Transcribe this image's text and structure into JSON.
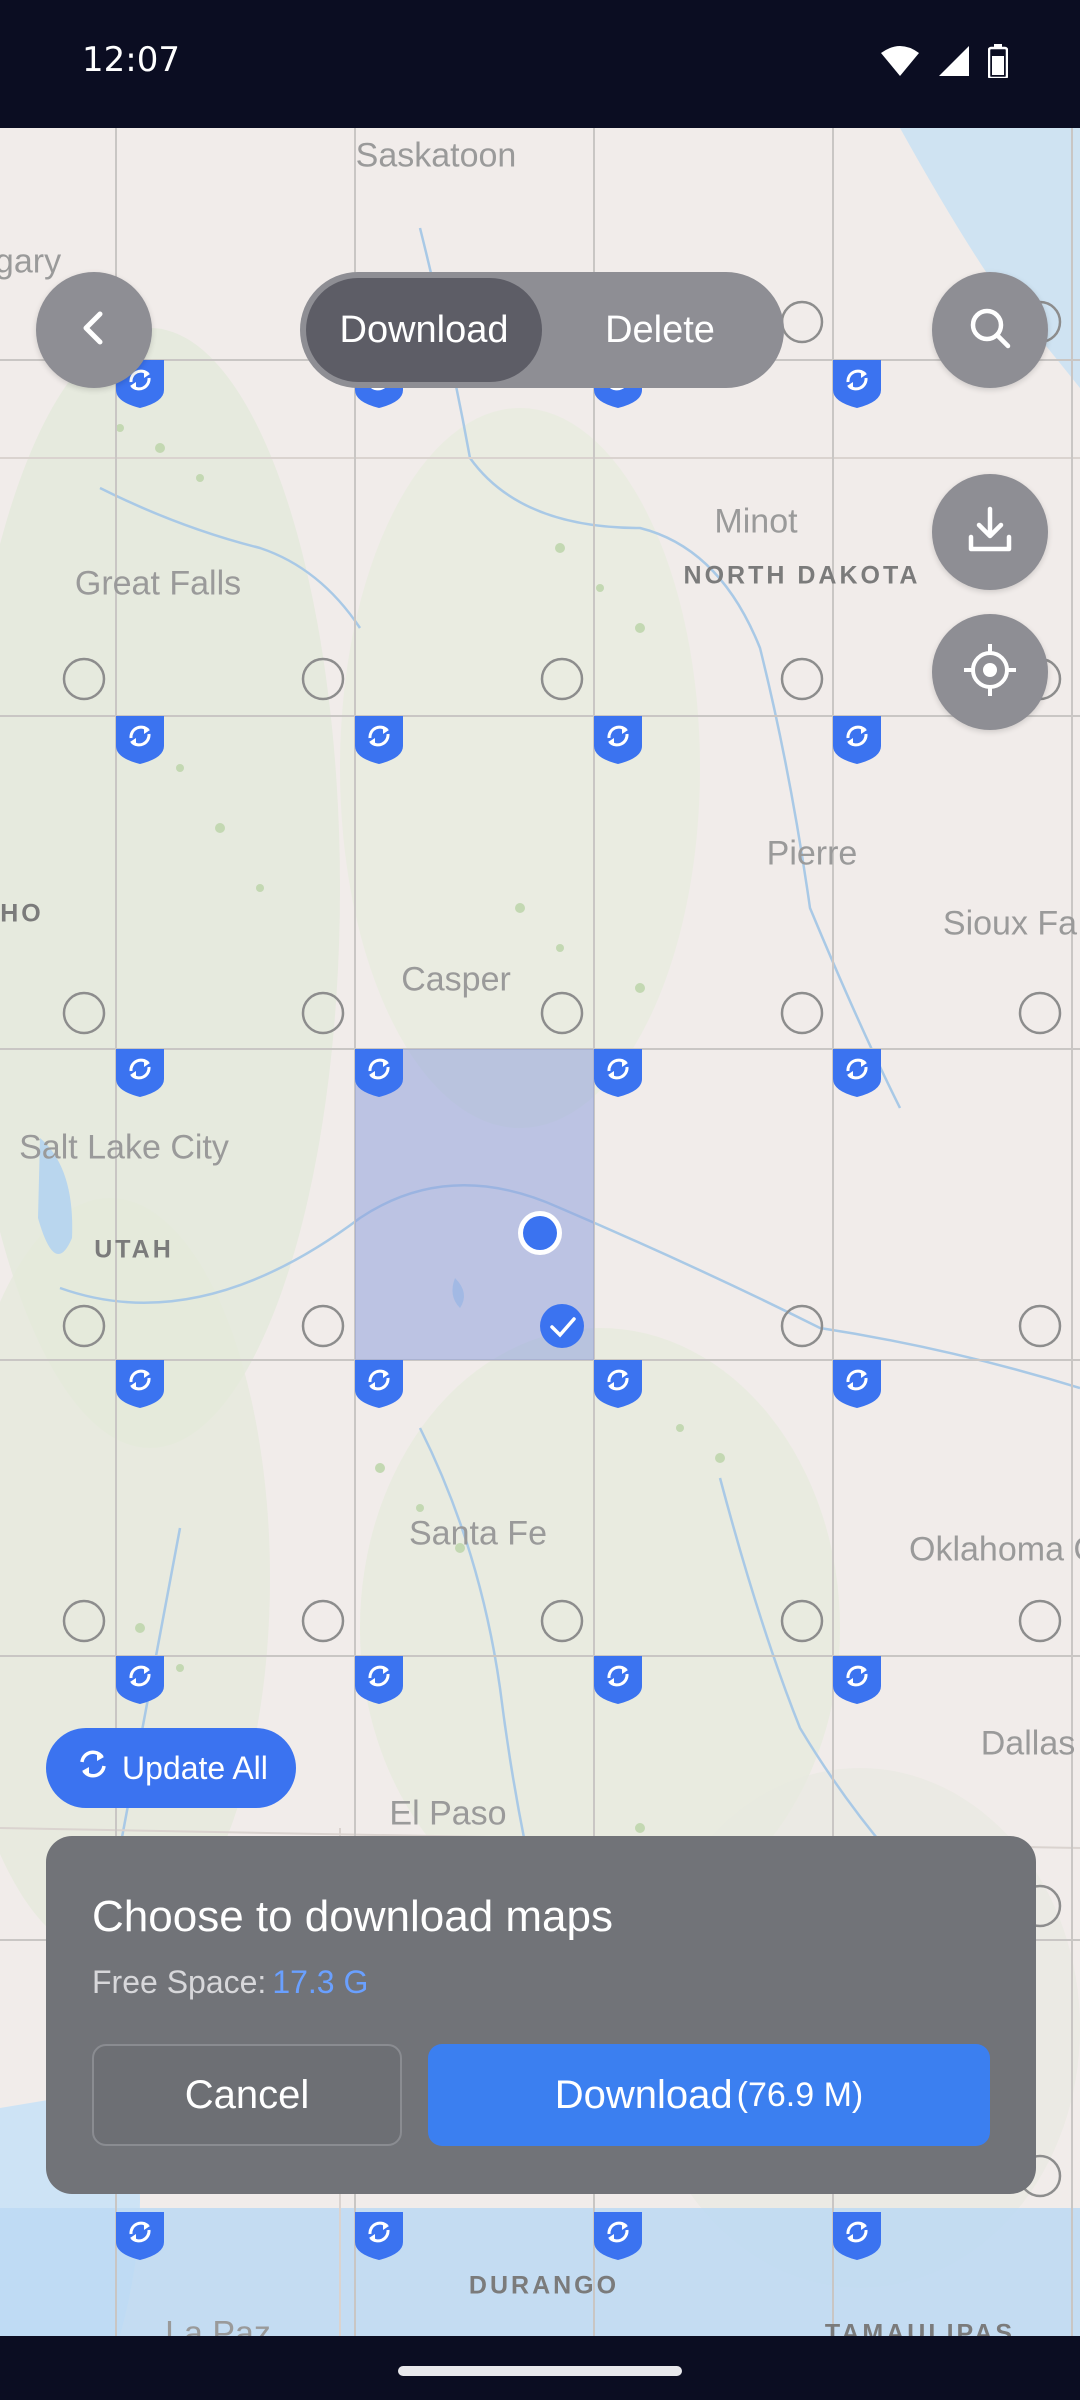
{
  "status_bar": {
    "time": "12:07"
  },
  "toolbar": {
    "back_icon": "chevron-left-icon",
    "segmented": [
      {
        "label": "Download",
        "selected": true
      },
      {
        "label": "Delete",
        "selected": false
      }
    ],
    "search_icon": "search-icon",
    "download_icon": "download-icon",
    "locate_icon": "crosshair-icon"
  },
  "map": {
    "cities": [
      "Saskatoon",
      "gary",
      "Great Falls",
      "Minot",
      "Pierre",
      "Sioux Fa",
      "Casper",
      "Salt Lake City",
      "Santa Fe",
      "Oklahoma Cit",
      "Dallas",
      "El Paso",
      "La Paz"
    ],
    "states": [
      "NORTH DAKOTA",
      "HO",
      "UTAH",
      "DURANGO",
      "TAMAULIPAS"
    ],
    "selected_tile": {
      "status": "checked"
    },
    "colors": {
      "selection": "#8fa3dd",
      "accent": "#3b73f0",
      "grid": "#c9c6c4"
    }
  },
  "update_all": {
    "label": "Update All"
  },
  "sheet": {
    "title": "Choose to download maps",
    "free_space_label": "Free Space:",
    "free_space_value": "17.3 G",
    "cancel_label": "Cancel",
    "download_label": "Download",
    "download_size": "(76.9 M)"
  }
}
